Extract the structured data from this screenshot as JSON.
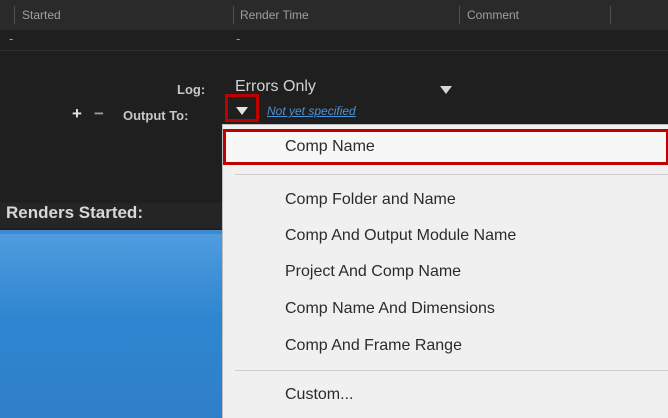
{
  "header": {
    "columns": {
      "started": "Started",
      "render_time": "Render Time",
      "comment": "Comment"
    }
  },
  "dash_row": {
    "started_dash": "-",
    "render_time_dash": "-"
  },
  "log": {
    "label": "Log:",
    "value": "Errors Only"
  },
  "output_to": {
    "add_symbol": "+",
    "remove_symbol": "−",
    "label": "Output To:",
    "value": "Not yet specified"
  },
  "renders_started": {
    "label": "Renders Started:"
  },
  "menu": {
    "items": [
      {
        "label": "Comp Name",
        "selected": true
      },
      {
        "label": "Comp Folder and Name"
      },
      {
        "label": "Comp And Output Module Name"
      },
      {
        "label": "Project And Comp Name"
      },
      {
        "label": "Comp Name And Dimensions"
      },
      {
        "label": "Comp And Frame Range"
      },
      {
        "label": "Custom..."
      }
    ]
  },
  "colors": {
    "highlight_border": "#c00000",
    "link_blue": "#4b92d6",
    "panel_blue": "#2f86d0",
    "background_dark": "#1f1f1f",
    "menu_bg": "#f0f0f0"
  },
  "icons": {
    "log_caret": "chevron-down-icon",
    "output_caret": "chevron-down-icon"
  }
}
